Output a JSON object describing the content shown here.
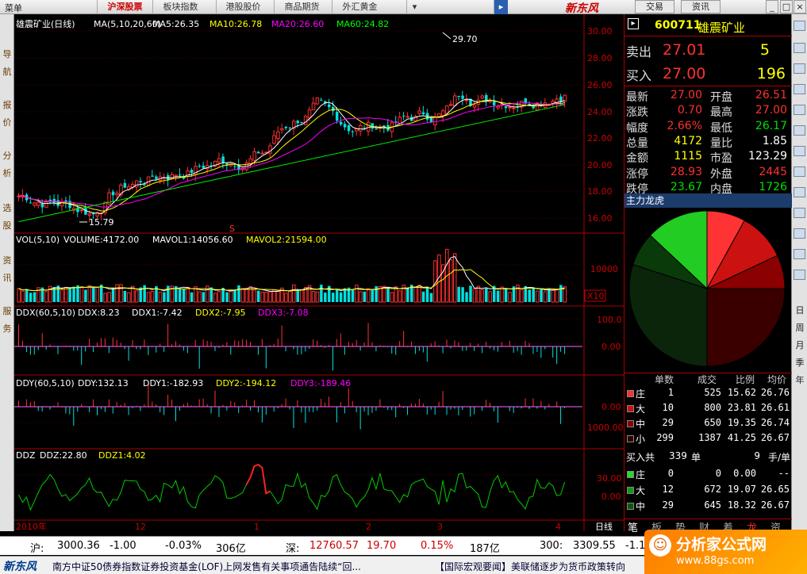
{
  "menu_label": "菜单",
  "tabs": [
    "沪深股票",
    "板块指数",
    "港股股价",
    "商品期货",
    "外汇黄金"
  ],
  "brand": "新东风",
  "right_buttons": [
    "交易",
    "资讯"
  ],
  "left_sidebar": [
    "导",
    "航",
    "报",
    "价",
    "分",
    "析",
    "选",
    "股",
    "资",
    "讯",
    "服",
    "务"
  ],
  "right_sidebar_labels": [
    "日",
    "周",
    "月",
    "季",
    "年"
  ],
  "chart_header": {
    "title": "雄震矿业(日线)",
    "ma_label": "MA(5,10,20,60)",
    "ma5": "MA5:26.35",
    "ma10": "MA10:26.78",
    "ma20": "MA20:26.60",
    "ma60": "MA60:24.82"
  },
  "price_axis": [
    "30.00",
    "28.00",
    "26.00",
    "24.00",
    "22.00",
    "20.00",
    "18.00",
    "16.00"
  ],
  "price_markers": {
    "high": "29.70",
    "low": "15.79",
    "s_marker": "S"
  },
  "vol_header": {
    "label": "VOL(5,10)",
    "volume": "VOLUME:4172.00",
    "mavol1": "MAVOL1:14056.60",
    "mavol2": "MAVOL2:21594.00"
  },
  "vol_axis": [
    "10000"
  ],
  "vol_unit": "X10",
  "ddx_header": {
    "label": "DDX(60,5,10)",
    "ddx": "DDX:8.23",
    "ddx1": "DDX1:-7.42",
    "ddx2": "DDX2:-7.95",
    "ddx3": "DDX3:-7.08"
  },
  "ddx_axis": [
    "100.0",
    "0.00"
  ],
  "ddy_header": {
    "label": "DDY(60,5,10)",
    "ddy": "DDY:132.13",
    "ddy1": "DDY1:-182.93",
    "ddy2": "DDY2:-194.12",
    "ddy3": "DDY3:-189.46"
  },
  "ddy_axis": [
    "0.00",
    "1000.00"
  ],
  "ddz_header": {
    "label": "DDZ",
    "ddz": "DDZ:22.80",
    "ddz1": "DDZ1:4.02"
  },
  "ddz_axis": [
    "30.00",
    "0.00"
  ],
  "date_axis": [
    "2010年",
    "12",
    "1",
    "2",
    "3",
    "4"
  ],
  "period_label": "日线",
  "quote": {
    "code": "600711",
    "name": "雄震矿业",
    "sell_label": "卖出",
    "sell_price": "27.01",
    "sell_vol": "5",
    "buy_label": "买入",
    "buy_price": "27.00",
    "buy_vol": "196",
    "rows": [
      {
        "k1": "最新",
        "v1": "27.00",
        "k2": "开盘",
        "v2": "26.51"
      },
      {
        "k1": "涨跌",
        "v1": "0.70",
        "k2": "最高",
        "v2": "27.00"
      },
      {
        "k1": "幅度",
        "v1": "2.66%",
        "k2": "最低",
        "v2": "26.17"
      },
      {
        "k1": "总量",
        "v1": "4172",
        "k2": "量比",
        "v2": "1.85"
      },
      {
        "k1": "金额",
        "v1": "1115",
        "k2": "市盈",
        "v2": "123.29"
      },
      {
        "k1": "涨停",
        "v1": "28.93",
        "k2": "外盘",
        "v2": "2445"
      },
      {
        "k1": "跌停",
        "v1": "23.67",
        "k2": "内盘",
        "v2": "1726"
      }
    ]
  },
  "pie_title": "主力龙虎",
  "pie_data": {
    "type": "pie",
    "slices": [
      {
        "value": 8,
        "color": "#ff3333"
      },
      {
        "value": 10,
        "color": "#cc1111"
      },
      {
        "value": 7,
        "color": "#8b0000"
      },
      {
        "value": 25,
        "color": "#3a0000"
      },
      {
        "value": 30,
        "color": "#0a250a"
      },
      {
        "value": 7,
        "color": "#0a3a0a"
      },
      {
        "value": 13,
        "color": "#22cc22"
      }
    ]
  },
  "order_headers": [
    "单数",
    "成交",
    "比例",
    "均价"
  ],
  "sell_orders": [
    {
      "type": "庄",
      "count": "1",
      "volume": "525",
      "ratio": "15.62",
      "avg": "26.76",
      "color": "#ff3030"
    },
    {
      "type": "大",
      "count": "10",
      "volume": "800",
      "ratio": "23.81",
      "avg": "26.61",
      "color": "#cc1010"
    },
    {
      "type": "中",
      "count": "29",
      "volume": "650",
      "ratio": "19.35",
      "avg": "26.74",
      "color": "#880000"
    },
    {
      "type": "小",
      "count": "299",
      "volume": "1387",
      "ratio": "41.25",
      "avg": "26.67",
      "color": "#300000"
    }
  ],
  "buy_summary": {
    "label": "买入共",
    "count": "339",
    "unit": "单",
    "hands": "9",
    "hands_unit": "手/单"
  },
  "buy_orders": [
    {
      "type": "庄",
      "count": "0",
      "volume": "0",
      "ratio": "0.00",
      "avg": "--",
      "color": "#22dd22"
    },
    {
      "type": "大",
      "count": "12",
      "volume": "672",
      "ratio": "19.07",
      "avg": "26.65",
      "color": "#119911"
    },
    {
      "type": "中",
      "count": "29",
      "volume": "645",
      "ratio": "18.32",
      "avg": "26.67",
      "color": "#0a5a0a"
    }
  ],
  "bottom_tabs": [
    "笔",
    "板",
    "势",
    "财",
    "着",
    "龙",
    "资"
  ],
  "status": {
    "sh_label": "沪:",
    "sh_index": "3000.36",
    "sh_change": "-1.00",
    "sh_pct": "-0.03%",
    "sh_amount": "306亿",
    "sz_label": "深:",
    "sz_index": "12760.57",
    "sz_change": "19.70",
    "sz_pct": "0.15%",
    "sz_amount": "187亿",
    "c300_label": "300:",
    "c300_index": "3309.55",
    "c300_change": "-1.1"
  },
  "news": {
    "logo": "新东风",
    "item1": "南方中证50债券指数证券投资基金(LOF)上网发售有关事项通告陆续“回...",
    "item2": "【国际宏观要闻】美联储逐步为货币政策转向"
  },
  "watermark": {
    "title": "分析家公式网",
    "url": "www.88gs.com"
  }
}
